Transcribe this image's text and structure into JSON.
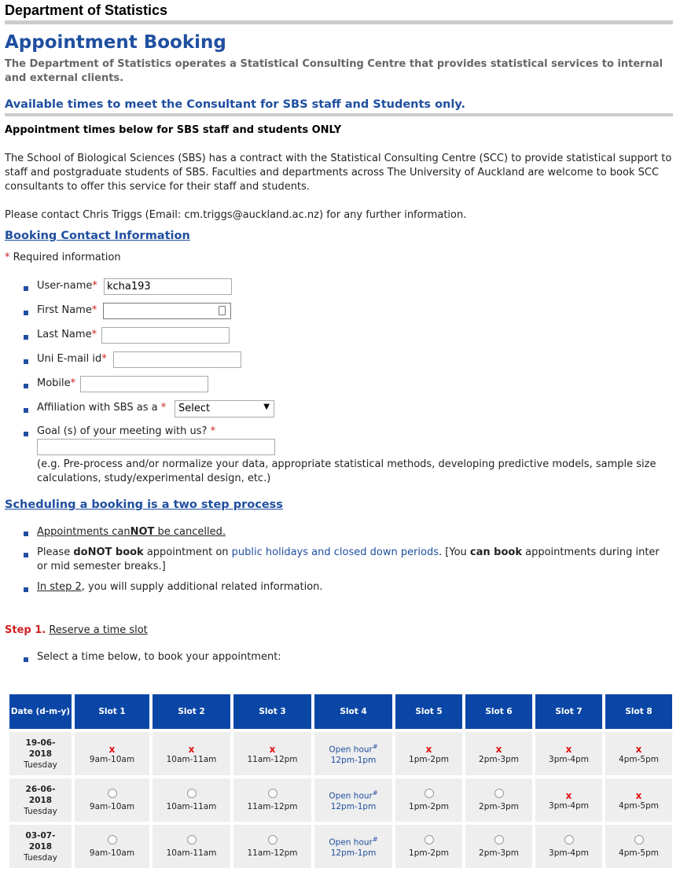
{
  "header": {
    "dept_title": "Department of Statistics",
    "page_title": "Appointment Booking",
    "intro": "The Department of Statistics operates a Statistical Consulting Centre that provides statistical services to internal and external clients.",
    "available_heading": "Available times to meet the Consultant for SBS staff and Students only."
  },
  "notice": {
    "heading": "Appointment times below for SBS staff and students ONLY",
    "para1": "The School of Biological Sciences (SBS) has a contract with the Statistical Consulting Centre (SCC) to provide statistical support to staff and postgraduate students of SBS. Faculties and departments across The University of Auckland are welcome to book SCC consultants to offer this service for their staff and students.",
    "para2": "Please contact Chris Triggs (Email: cm.triggs@auckland.ac.nz) for any further information."
  },
  "form": {
    "section_title": "Booking Contact Information",
    "required_note": "Required information",
    "asterisk": "*",
    "username_label": "User-name",
    "username_value": "kcha193",
    "firstname_label": "First Name",
    "lastname_label": "Last Name",
    "email_label": "Uni E-mail id",
    "mobile_label": "Mobile",
    "affiliation_label": "Affiliation with SBS as a",
    "affiliation_value": "Select",
    "goal_label": "Goal (s) of your meeting with us?",
    "goal_hint": "(e.g. Pre-process and/or normalize your data, appropriate statistical methods, developing predictive models, sample size calculations, study/experimental design, etc.)"
  },
  "process": {
    "title": "Scheduling a booking is a two step process",
    "b1_pre": "Appointments ",
    "b1_can": "can",
    "b1_not": "NOT",
    "b1_post": " be cancelled.",
    "b2_pre": "Please ",
    "b2_bold1": "doNOT book",
    "b2_mid": " appointment on ",
    "b2_link": "public holidays and closed down periods",
    "b2_mid2": ". [You ",
    "b2_bold2": "can book",
    "b2_post": " appointments during inter or mid semester breaks.]",
    "b3_link": "In step 2",
    "b3_post": ", you will supply additional related information.",
    "step1_label": "Step 1.",
    "step1_text": "Reserve a time slot",
    "select_text": "Select a time below, to book your appointment:"
  },
  "schedule": {
    "headers": [
      "Date (d-m-y)",
      "Slot 1",
      "Slot 2",
      "Slot 3",
      "Slot 4",
      "Slot 5",
      "Slot 6",
      "Slot 7",
      "Slot 8"
    ],
    "open_hour_label": "Open hour",
    "open_hour_mark": "#",
    "rows": [
      {
        "date": "19-06-2018",
        "weekday": "Tuesday",
        "slots": [
          {
            "state": "booked",
            "time": "9am-10am"
          },
          {
            "state": "booked",
            "time": "10am-11am"
          },
          {
            "state": "booked",
            "time": "11am-12pm"
          },
          {
            "state": "open",
            "time": "12pm-1pm"
          },
          {
            "state": "booked",
            "time": "1pm-2pm"
          },
          {
            "state": "booked",
            "time": "2pm-3pm"
          },
          {
            "state": "booked",
            "time": "3pm-4pm"
          },
          {
            "state": "booked",
            "time": "4pm-5pm"
          }
        ]
      },
      {
        "date": "26-06-2018",
        "weekday": "Tuesday",
        "slots": [
          {
            "state": "available",
            "time": "9am-10am"
          },
          {
            "state": "available",
            "time": "10am-11am"
          },
          {
            "state": "available",
            "time": "11am-12pm"
          },
          {
            "state": "open",
            "time": "12pm-1pm"
          },
          {
            "state": "available",
            "time": "1pm-2pm"
          },
          {
            "state": "available",
            "time": "2pm-3pm"
          },
          {
            "state": "booked",
            "time": "3pm-4pm"
          },
          {
            "state": "booked",
            "time": "4pm-5pm"
          }
        ]
      },
      {
        "date": "03-07-2018",
        "weekday": "Tuesday",
        "slots": [
          {
            "state": "available",
            "time": "9am-10am"
          },
          {
            "state": "available",
            "time": "10am-11am"
          },
          {
            "state": "available",
            "time": "11am-12pm"
          },
          {
            "state": "open",
            "time": "12pm-1pm"
          },
          {
            "state": "available",
            "time": "1pm-2pm"
          },
          {
            "state": "available",
            "time": "2pm-3pm"
          },
          {
            "state": "available",
            "time": "3pm-4pm"
          },
          {
            "state": "available",
            "time": "4pm-5pm"
          }
        ]
      }
    ]
  },
  "colors": {
    "brand_blue": "#1f4fa0",
    "header_cell": "#0a46a6",
    "required_red": "#d02020",
    "booked_red": "#e01010"
  }
}
